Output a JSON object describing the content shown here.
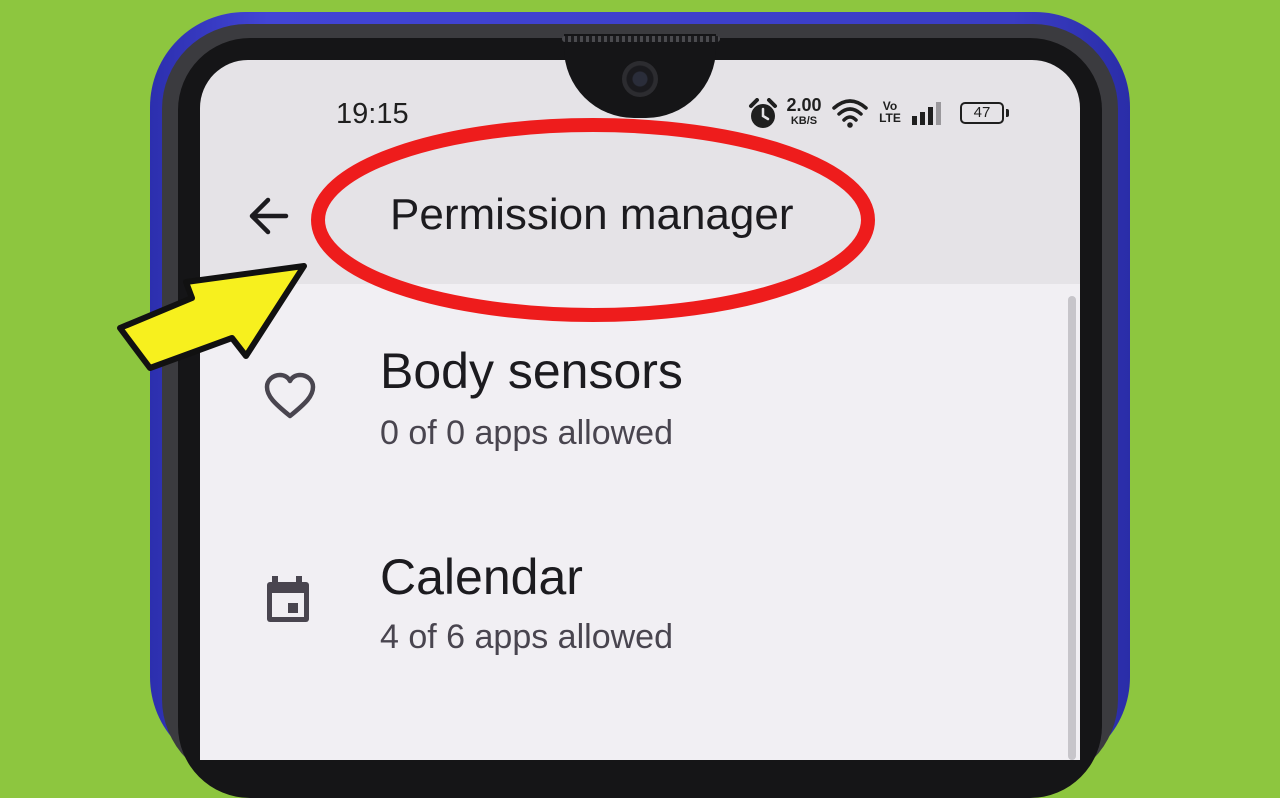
{
  "status_bar": {
    "time": "19:15",
    "net_speed_value": "2.00",
    "net_speed_unit": "KB/S",
    "volte_line1": "Vo",
    "volte_line2": "LTE",
    "battery_percent": "47",
    "icons": [
      "alarm-icon",
      "wifi-icon",
      "signal-icon",
      "battery-icon"
    ]
  },
  "app_bar": {
    "title": "Permission manager",
    "back_icon": "arrow-back-icon"
  },
  "permissions": [
    {
      "title": "Body sensors",
      "subtitle": "0 of 0 apps allowed",
      "icon": "heart-icon"
    },
    {
      "title": "Calendar",
      "subtitle": "4 of 6 apps allowed",
      "icon": "calendar-icon"
    }
  ],
  "colors": {
    "background_green": "#8dc63f",
    "phone_frame_blue": "#3a3dc4",
    "highlight_red": "#ee1c1c",
    "arrow_yellow": "#f7f01e",
    "screen_header": "#e5e3e7",
    "screen_list": "#f1eff3"
  }
}
